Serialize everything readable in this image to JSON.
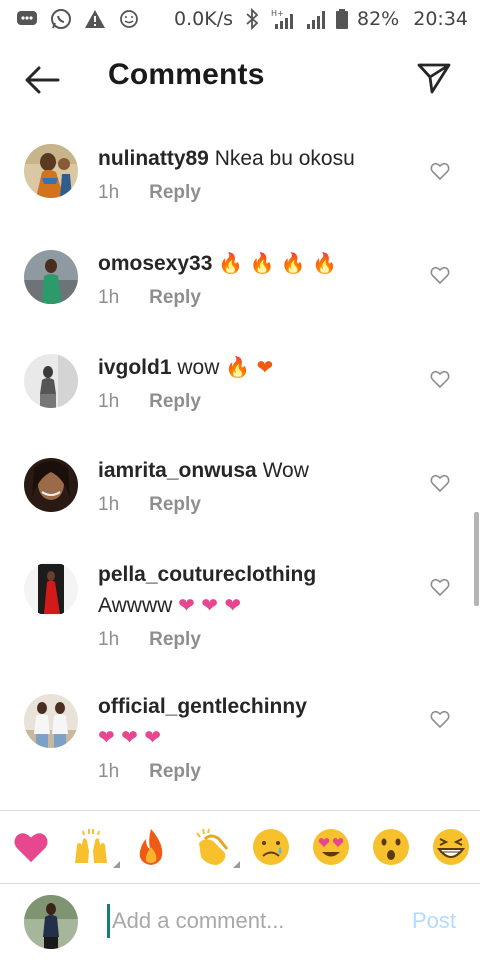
{
  "status_bar": {
    "icons": [
      "chat-bubble-icon",
      "whatsapp-icon",
      "warning-icon",
      "smiley-notification-icon"
    ],
    "net_speed": "0.0K/s",
    "icons_right": [
      "bluetooth-icon",
      "signal-h-plus-icon",
      "signal-bars-icon",
      "battery-icon"
    ],
    "battery": "82%",
    "time": "20:34"
  },
  "header": {
    "title": "Comments",
    "back_icon": "arrow-left-icon",
    "send_icon": "paper-plane-icon"
  },
  "comments": [
    {
      "username": "nulinatty89",
      "text": "Nkea bu okosu",
      "emojis": "",
      "time": "1h",
      "reply": "Reply"
    },
    {
      "username": "omosexy33",
      "text": "",
      "emojis": "🔥 🔥 🔥 🔥",
      "time": "1h",
      "reply": "Reply"
    },
    {
      "username": "ivgold1",
      "text": "wow",
      "emojis": "🔥 ❤",
      "time": "1h",
      "reply": "Reply"
    },
    {
      "username": "iamrita_onwusa",
      "text": "Wow",
      "emojis": "",
      "time": "1h",
      "reply": "Reply"
    },
    {
      "username": "pella_coutureclothing",
      "text": "Awwww",
      "emojis": "❤ ❤ ❤",
      "time": "1h",
      "reply": "Reply"
    },
    {
      "username": "official_gentlechinny",
      "text": "",
      "emojis": "❤ ❤ ❤",
      "time": "1h",
      "reply": "Reply"
    }
  ],
  "emoji_bar": [
    "red-heart",
    "raising-hands",
    "fire",
    "clapping-hands",
    "crying-face",
    "heart-eyes-face",
    "surprised-face",
    "grinning-squinting-face"
  ],
  "input": {
    "placeholder": "Add a comment...",
    "value": "",
    "post_label": "Post"
  },
  "colors": {
    "post_disabled": "#b3dbff",
    "meta_gray": "#8e8e8e",
    "fire": "#ef5a14",
    "heart": "#e6478f"
  }
}
